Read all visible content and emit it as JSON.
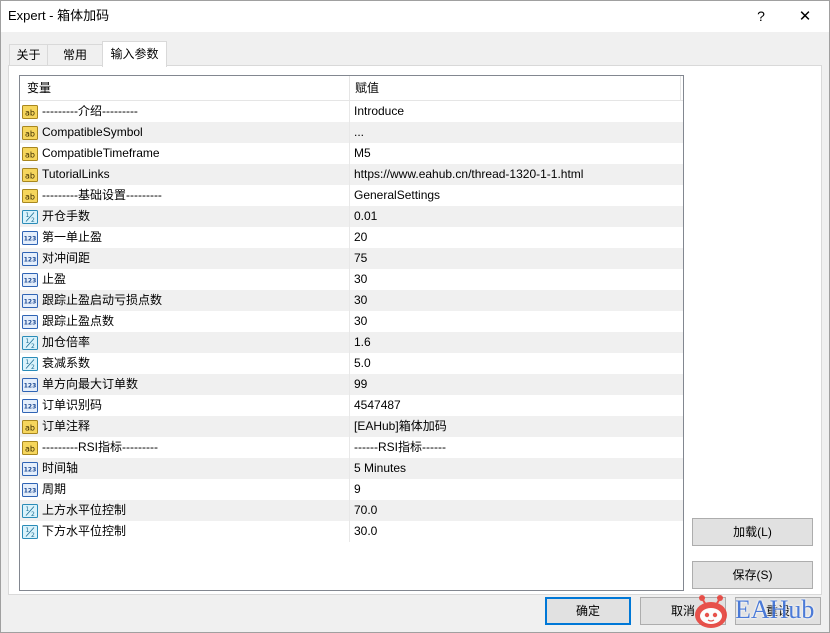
{
  "window": {
    "title": "Expert - 箱体加码",
    "help_label": "?",
    "close_label": "✕"
  },
  "tabs": [
    {
      "label": "关于",
      "active": false
    },
    {
      "label": "常用",
      "active": false
    },
    {
      "label": "输入参数",
      "active": true
    }
  ],
  "inputs": {
    "headers": {
      "variable": "变量",
      "value": "赋值"
    },
    "rows": [
      {
        "icon": "string-type-icon",
        "name": "---------介绍---------",
        "value": "Introduce"
      },
      {
        "icon": "string-type-icon",
        "name": "CompatibleSymbol",
        "value": "..."
      },
      {
        "icon": "string-type-icon",
        "name": "CompatibleTimeframe",
        "value": "M5"
      },
      {
        "icon": "string-type-icon",
        "name": "TutorialLinks",
        "value": "https://www.eahub.cn/thread-1320-1-1.html"
      },
      {
        "icon": "string-type-icon",
        "name": "---------基础设置---------",
        "value": "GeneralSettings"
      },
      {
        "icon": "double-type-icon",
        "name": "开仓手数",
        "value": "0.01"
      },
      {
        "icon": "integer-type-icon",
        "name": "第一单止盈",
        "value": "20"
      },
      {
        "icon": "integer-type-icon",
        "name": "对冲间距",
        "value": "75"
      },
      {
        "icon": "integer-type-icon",
        "name": "止盈",
        "value": "30"
      },
      {
        "icon": "integer-type-icon",
        "name": "跟踪止盈启动亏损点数",
        "value": "30"
      },
      {
        "icon": "integer-type-icon",
        "name": "跟踪止盈点数",
        "value": "30"
      },
      {
        "icon": "double-type-icon",
        "name": "加仓倍率",
        "value": "1.6"
      },
      {
        "icon": "double-type-icon",
        "name": "衰减系数",
        "value": "5.0"
      },
      {
        "icon": "integer-type-icon",
        "name": "单方向最大订单数",
        "value": "99"
      },
      {
        "icon": "integer-type-icon",
        "name": "订单识别码",
        "value": "4547487"
      },
      {
        "icon": "string-type-icon",
        "name": "订单注释",
        "value": "[EAHub]箱体加码"
      },
      {
        "icon": "string-type-icon",
        "name": "---------RSI指标---------",
        "value": "------RSI指标------"
      },
      {
        "icon": "integer-type-icon",
        "name": "时间轴",
        "value": "5 Minutes"
      },
      {
        "icon": "integer-type-icon",
        "name": "周期",
        "value": "9"
      },
      {
        "icon": "double-type-icon",
        "name": "上方水平位控制",
        "value": "70.0"
      },
      {
        "icon": "double-type-icon",
        "name": "下方水平位控制",
        "value": "30.0"
      }
    ]
  },
  "side_buttons": {
    "load_label": "加载(L)",
    "save_label": "保存(S)"
  },
  "footer": {
    "ok_label": "确定",
    "cancel_label": "取消",
    "reset_label": "重设"
  },
  "watermark": {
    "text": "EAHub",
    "icon": "eahub-mascot-icon"
  },
  "colors": {
    "accent": "#0078d7",
    "row_alt": "#f0f0f0",
    "watermark_text": "#3b6fd6",
    "watermark_mascot": "#e8423b"
  }
}
